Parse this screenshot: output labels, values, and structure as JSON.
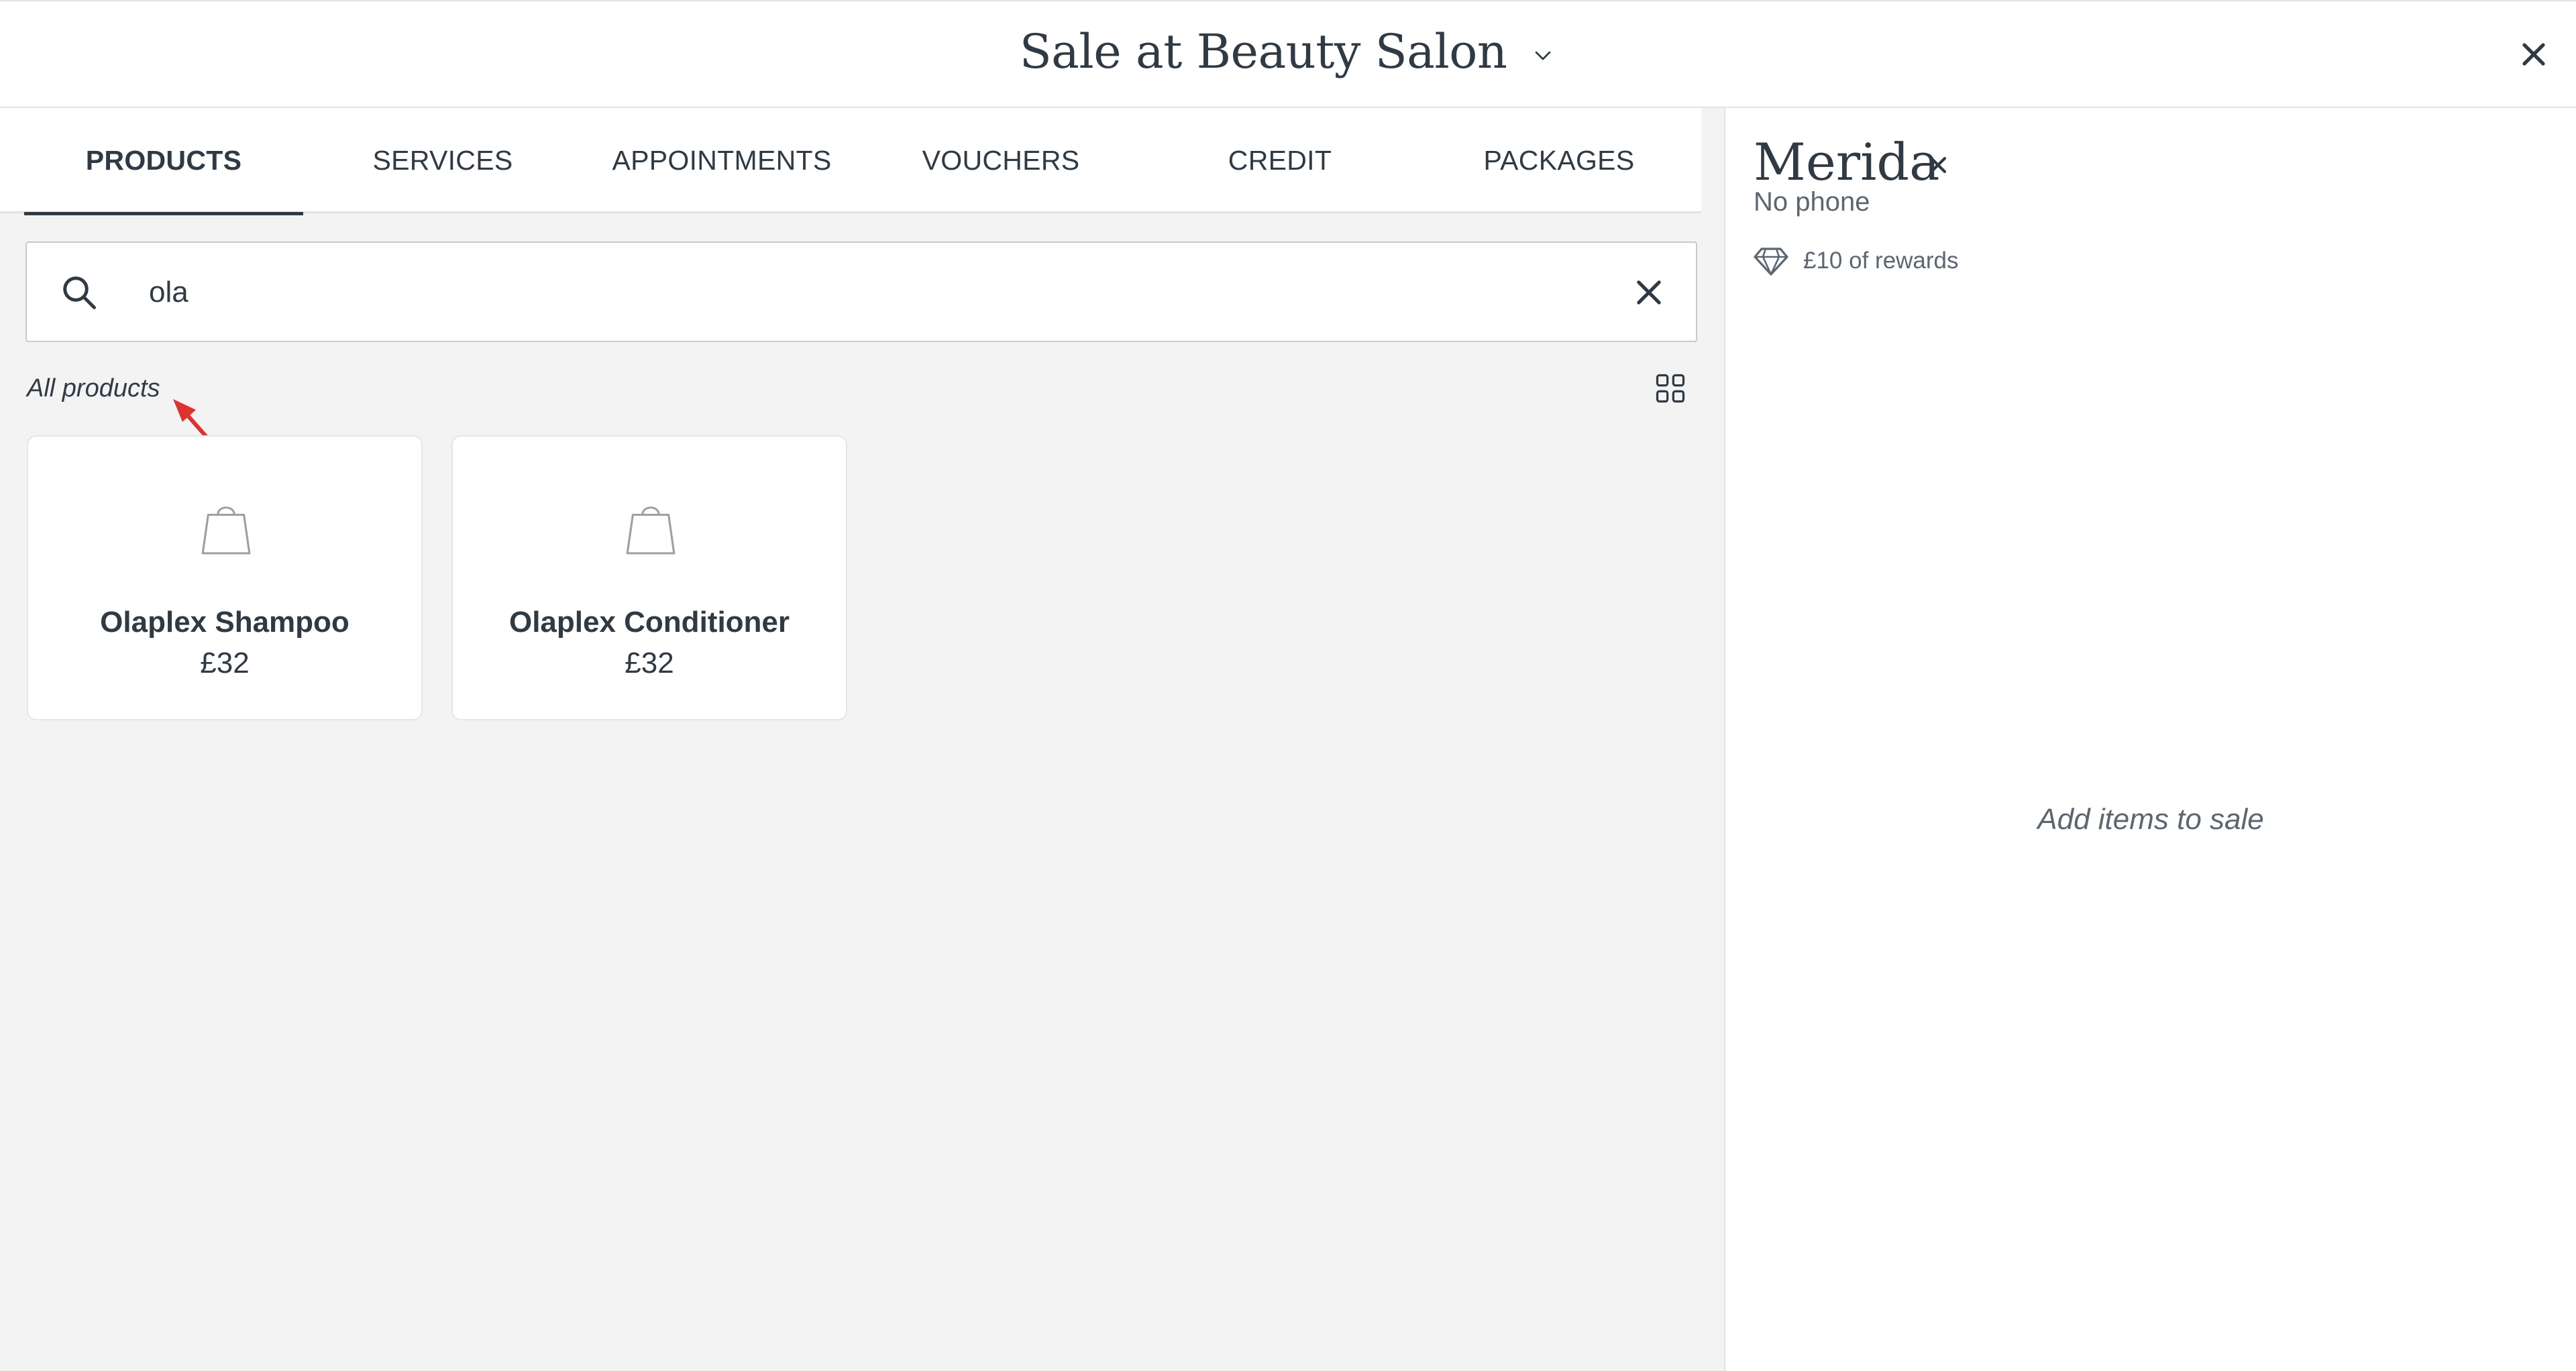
{
  "header": {
    "title": "Sale at Beauty Salon"
  },
  "tabs": [
    {
      "label": "PRODUCTS",
      "active": true
    },
    {
      "label": "SERVICES",
      "active": false
    },
    {
      "label": "APPOINTMENTS",
      "active": false
    },
    {
      "label": "VOUCHERS",
      "active": false
    },
    {
      "label": "CREDIT",
      "active": false
    },
    {
      "label": "PACKAGES",
      "active": false
    }
  ],
  "search": {
    "value": "ola",
    "placeholder": ""
  },
  "products": {
    "section_label": "All products",
    "items": [
      {
        "name": "Olaplex Shampoo",
        "price": "£32"
      },
      {
        "name": "Olaplex Conditioner",
        "price": "£32"
      }
    ]
  },
  "client": {
    "name": "Merida",
    "phone": "No phone",
    "rewards": "£10 of rewards"
  },
  "sale": {
    "empty_message": "Add items to sale"
  },
  "icons": {
    "chevron": "chevron-down-icon",
    "close": "close-icon",
    "search": "search-icon",
    "clear": "clear-icon",
    "grid": "grid-view-icon",
    "bag": "shopping-bag-icon",
    "diamond": "diamond-icon"
  },
  "colors": {
    "text": "#2f3a44",
    "muted": "#5b6670",
    "panel_bg": "#f3f3f3",
    "annotation": "#e03131"
  }
}
